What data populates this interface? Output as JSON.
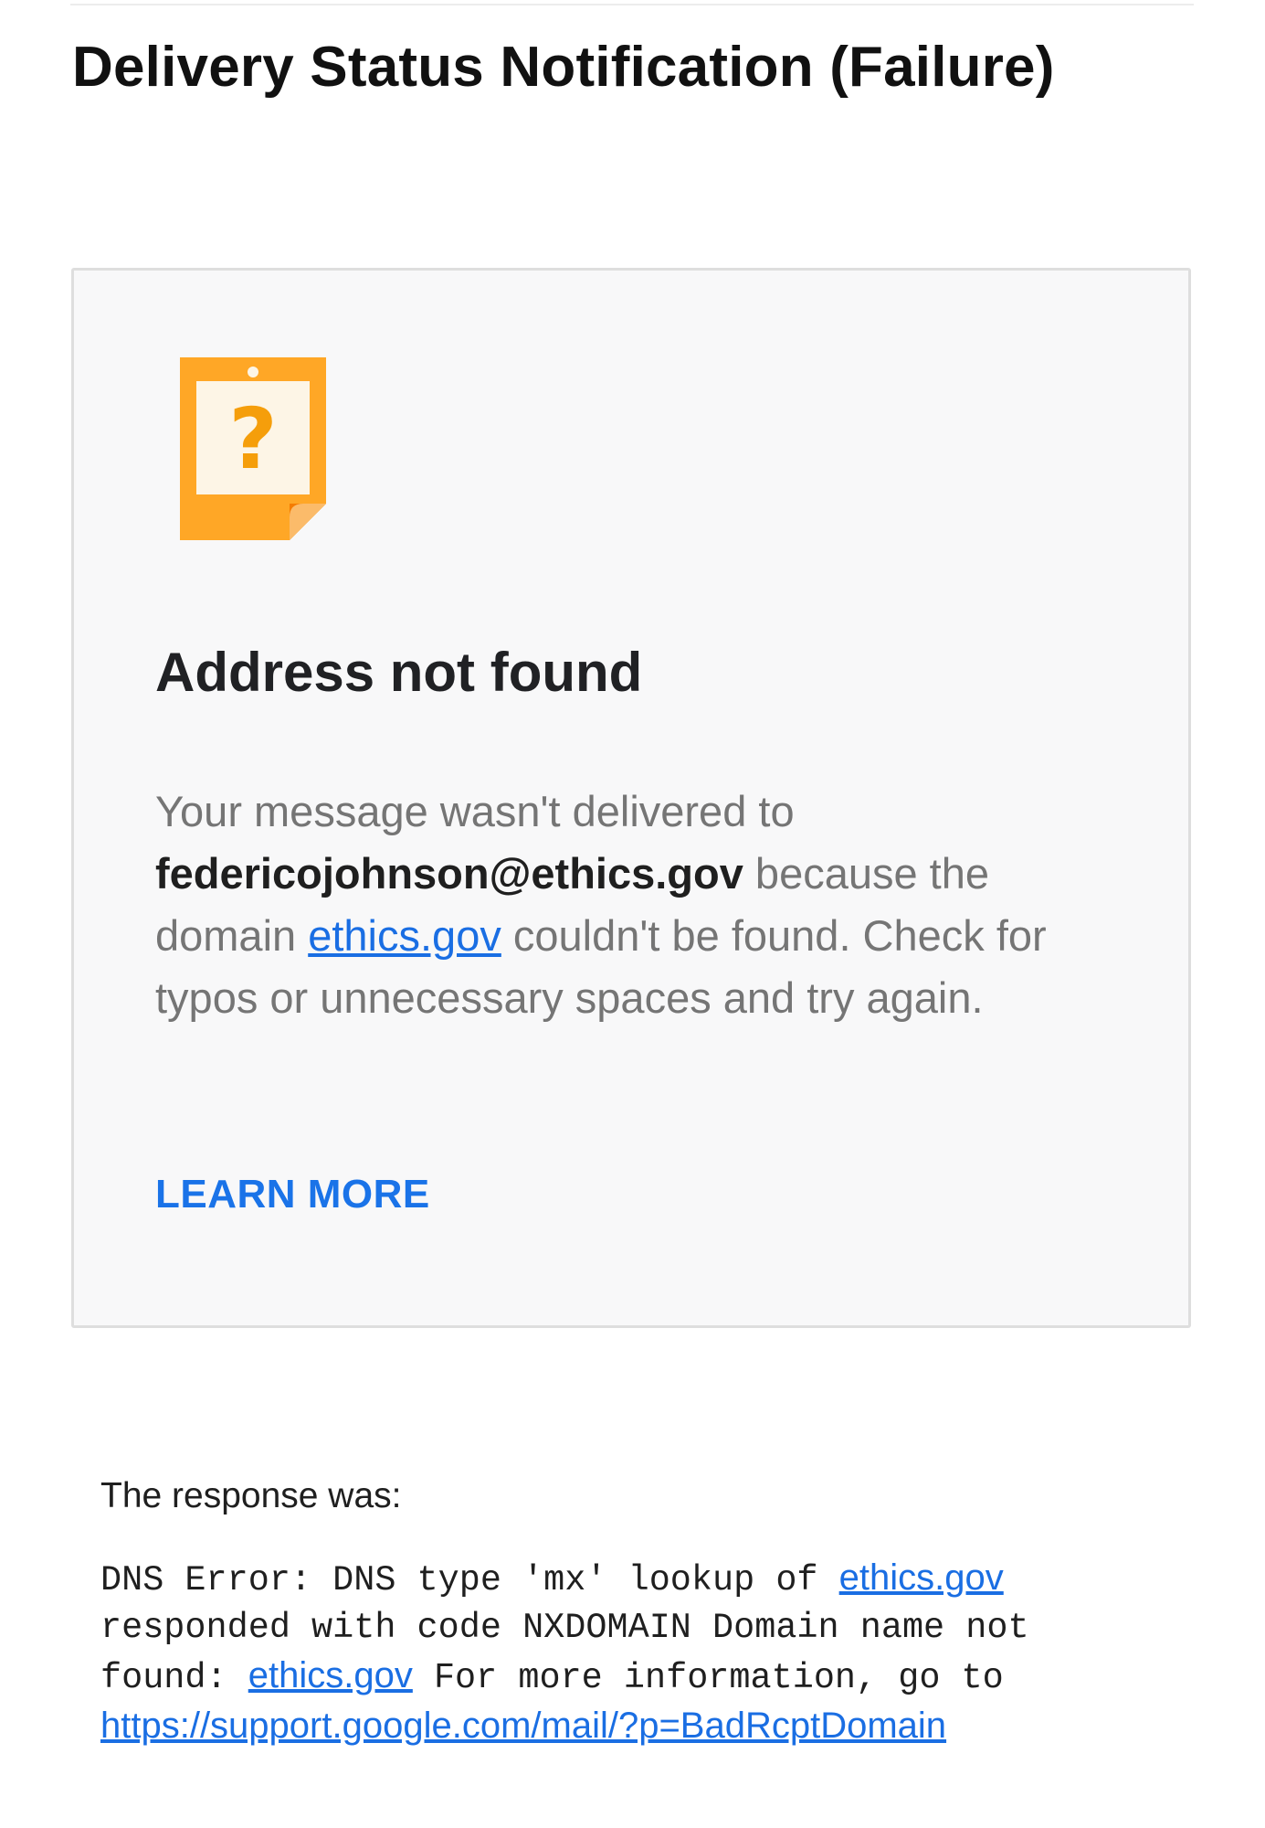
{
  "email": {
    "subject": "Delivery Status Notification (Failure)"
  },
  "card": {
    "icon": "unknown-address-note-icon",
    "icon_colors": {
      "paper": "#ffa726",
      "inner": "#fdf5e6",
      "glyph": "#f59e0b",
      "fold": "#f57c00"
    },
    "title": "Address not found",
    "body_intro": "Your message wasn't delivered to ",
    "recipient": "federicojohnson@ethics.gov",
    "body_mid": " because the domain ",
    "domain": "ethics.gov",
    "body_end": " couldn't be found. Check for typos or unnecessary spaces and try again.",
    "learn_more": "LEARN MORE"
  },
  "response": {
    "label": "The response was:",
    "part1": "DNS Error: DNS type 'mx' lookup of ",
    "domain1": "ethics.gov",
    "part2": " responded with code NXDOMAIN Domain name not found: ",
    "domain2": "ethics.gov",
    "part3": " For more information, go to ",
    "help_url": "https://support.google.com/mail/?p=BadRcptDomain"
  },
  "colors": {
    "link": "#1a73e8",
    "card_background": "#f8f8f9",
    "card_border": "#dedede",
    "muted_text": "#757575"
  }
}
